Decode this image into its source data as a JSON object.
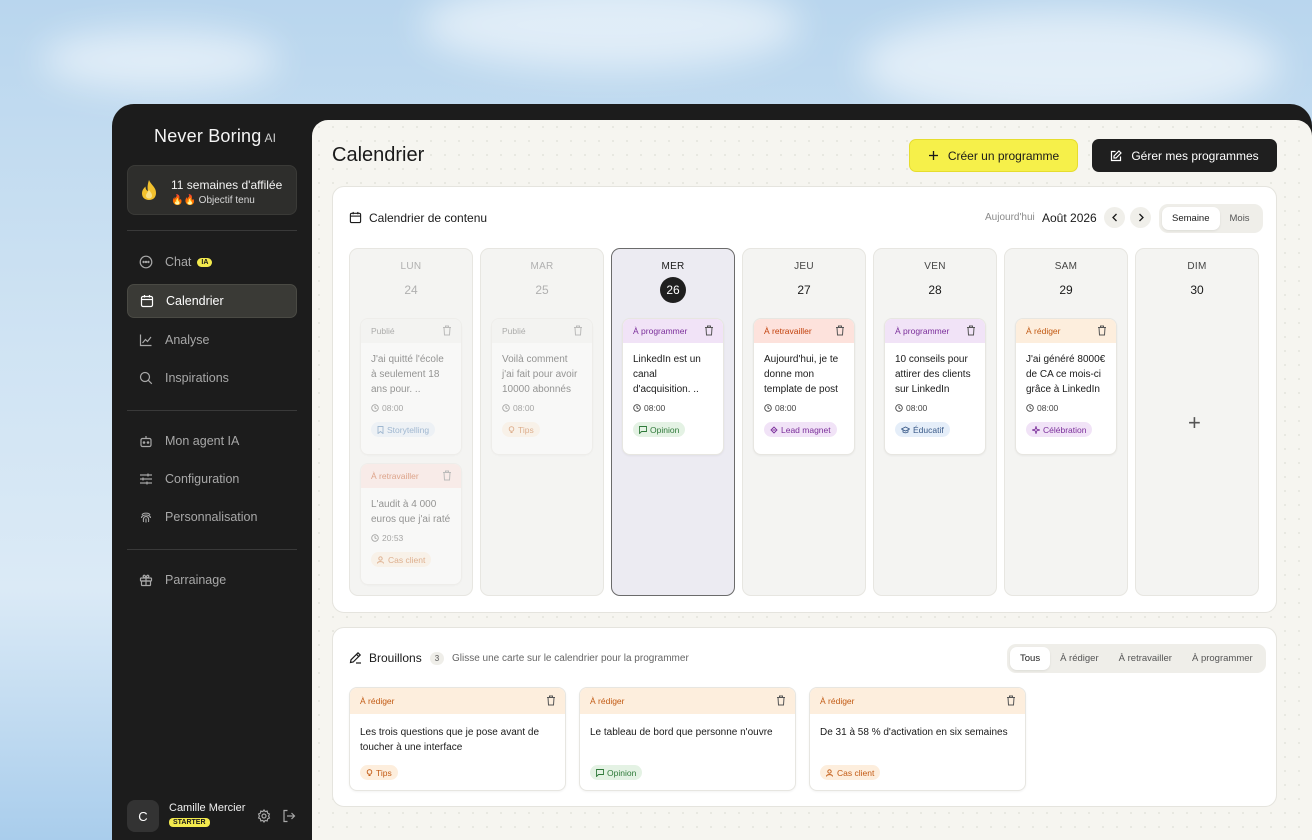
{
  "brand": {
    "name": "Never Boring",
    "suffix": "AI"
  },
  "streak": {
    "title": "11 semaines d'affilée",
    "subtitle": "🔥🔥 Objectif tenu"
  },
  "nav": [
    {
      "label": "Chat",
      "badge": "IA",
      "icon": "chat-icon"
    },
    {
      "label": "Calendrier",
      "icon": "calendar-icon",
      "active": true
    },
    {
      "label": "Analyse",
      "icon": "chart-icon"
    },
    {
      "label": "Inspirations",
      "icon": "search-icon"
    },
    {
      "label": "Mon agent IA",
      "icon": "robot-icon"
    },
    {
      "label": "Configuration",
      "icon": "sliders-icon"
    },
    {
      "label": "Personnalisation",
      "icon": "fingerprint-icon"
    },
    {
      "label": "Parrainage",
      "icon": "gift-icon"
    }
  ],
  "user": {
    "initial": "C",
    "name": "Camille Mercier",
    "plan": "STARTER"
  },
  "header": {
    "title": "Calendrier",
    "create_label": "Créer un programme",
    "manage_label": "Gérer mes programmes"
  },
  "calendar": {
    "title": "Calendrier de contenu",
    "today_label": "Aujourd'hui",
    "month_label": "Août 2026",
    "view_week": "Semaine",
    "view_month": "Mois",
    "days": [
      {
        "name": "LUN",
        "date": "24"
      },
      {
        "name": "MAR",
        "date": "25"
      },
      {
        "name": "MER",
        "date": "26"
      },
      {
        "name": "JEU",
        "date": "27"
      },
      {
        "name": "VEN",
        "date": "28"
      },
      {
        "name": "SAM",
        "date": "29"
      },
      {
        "name": "DIM",
        "date": "30"
      }
    ],
    "cards": {
      "lun1": {
        "status": "Publié",
        "text": "J'ai quitté l'école à seulement 18 ans pour. ..",
        "time": "08:00",
        "tag": "Storytelling"
      },
      "lun2": {
        "status": "À retravailler",
        "text": "L'audit à 4 000 euros que j'ai raté",
        "time": "20:53",
        "tag": "Cas client"
      },
      "mar1": {
        "status": "Publié",
        "text": "Voilà comment j'ai fait pour avoir 10000 abonnés",
        "time": "08:00",
        "tag": "Tips"
      },
      "mer1": {
        "status": "À programmer",
        "text": "LinkedIn est un canal d'acquisition. ..",
        "time": "08:00",
        "tag": "Opinion"
      },
      "jeu1": {
        "status": "À retravailler",
        "text": "Aujourd'hui, je te donne mon template de post",
        "time": "08:00",
        "tag": "Lead magnet"
      },
      "ven1": {
        "status": "À programmer",
        "text": "10 conseils pour attirer des clients sur LinkedIn",
        "time": "08:00",
        "tag": "Éducatif"
      },
      "sam1": {
        "status": "À rédiger",
        "text": "J'ai généré 8000€ de CA ce mois-ci grâce à LinkedIn",
        "time": "08:00",
        "tag": "Célébration"
      }
    },
    "add_symbol": "+"
  },
  "drafts": {
    "title": "Brouillons",
    "count": "3",
    "hint": "Glisse une carte sur le calendrier pour la programmer",
    "filters": [
      "Tous",
      "À rédiger",
      "À retravailler",
      "À programmer"
    ],
    "items": [
      {
        "status": "À rédiger",
        "text": "Les trois questions que je pose avant de toucher à une interface",
        "tag": "Tips"
      },
      {
        "status": "À rédiger",
        "text": "Le tableau de bord que personne n'ouvre",
        "tag": "Opinion"
      },
      {
        "status": "À rédiger",
        "text": "De 31 à 58 % d'activation en six semaines",
        "tag": "Cas client"
      }
    ]
  },
  "colors": {
    "accent_yellow": "#f6f04a",
    "status_published": "#f2f2f0",
    "status_rework": "#fde2dc",
    "status_program": "#f1e3f7",
    "status_draft": "#fdeedd"
  }
}
